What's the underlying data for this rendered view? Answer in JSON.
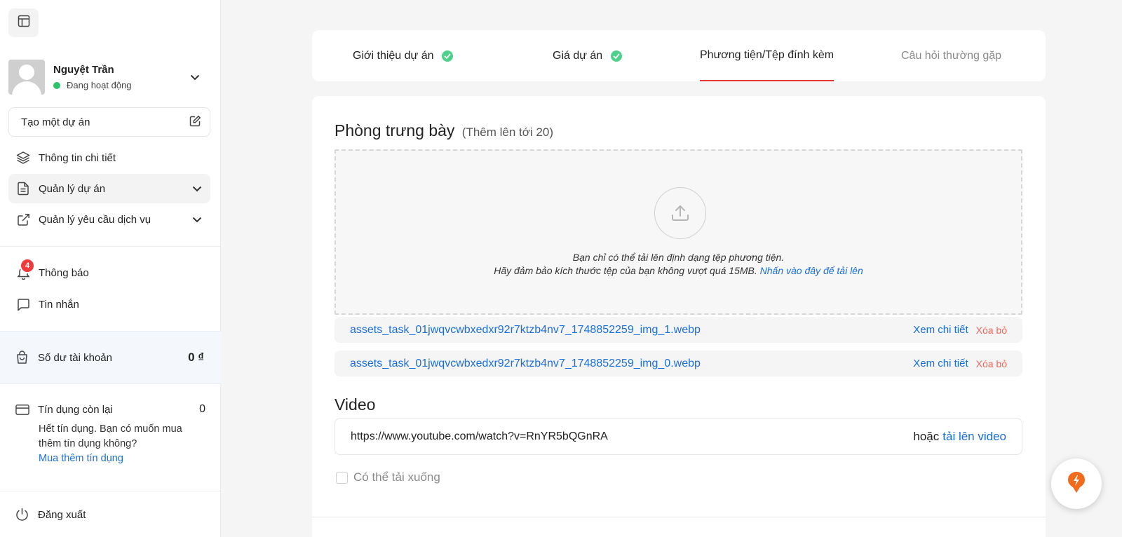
{
  "sidebar": {
    "user": {
      "name": "Nguyệt Trần",
      "status": "Đang hoạt động"
    },
    "create_project": "Tạo một dự án",
    "nav": [
      {
        "label": "Thông tin chi tiết",
        "icon": "layers-icon"
      },
      {
        "label": "Quản lý dự án",
        "icon": "document-icon"
      },
      {
        "label": "Quản lý yêu cầu dịch vụ",
        "icon": "external-link-icon"
      }
    ],
    "notifications": {
      "label": "Thông báo",
      "count": "4"
    },
    "messages": {
      "label": "Tin nhắn"
    },
    "balance": {
      "label": "Số dư tài khoản",
      "value": "0 ₫"
    },
    "credit": {
      "label": "Tín dụng còn lại",
      "value": "0",
      "message": "Hết tín dụng. Bạn có muốn mua thêm tín dụng không?",
      "link": "Mua thêm tín dụng"
    },
    "logout": "Đăng xuất"
  },
  "tabs": [
    {
      "label": "Giới thiệu dự án",
      "done": true
    },
    {
      "label": "Giá dự án",
      "done": true
    },
    {
      "label": "Phương tiện/Tệp đính kèm",
      "active": true
    },
    {
      "label": "Câu hỏi thường gặp"
    }
  ],
  "gallery": {
    "title": "Phòng trưng bày",
    "hint": "(Thêm lên tới 20)",
    "dropzone": {
      "line1": "Bạn chỉ có thể tải lên định dạng tệp phương tiện.",
      "line2": "Hãy đảm bảo kích thước tệp của bạn không vượt quá 15MB.",
      "link": "Nhấn vào đây để tải lên"
    },
    "files": [
      {
        "name": "assets_task_01jwqvcwbxedxr92r7ktzb4nv7_1748852259_img_1.webp",
        "view": "Xem chi tiết",
        "delete": "Xóa bỏ"
      },
      {
        "name": "assets_task_01jwqvcwbxedxr92r7ktzb4nv7_1748852259_img_0.webp",
        "view": "Xem chi tiết",
        "delete": "Xóa bỏ"
      }
    ]
  },
  "video": {
    "title": "Video",
    "url": "https://www.youtube.com/watch?v=RnYR5bQGnRA",
    "or": "hoặc",
    "upload": "tải lên video"
  },
  "downloadable": {
    "label": "Có thể tải xuống",
    "checked": false
  },
  "colors": {
    "accent": "#1a6fe0",
    "active_tab": "#e53935",
    "success": "#4cd08a",
    "danger": "#f0665a",
    "fab": "#f26b1d"
  }
}
